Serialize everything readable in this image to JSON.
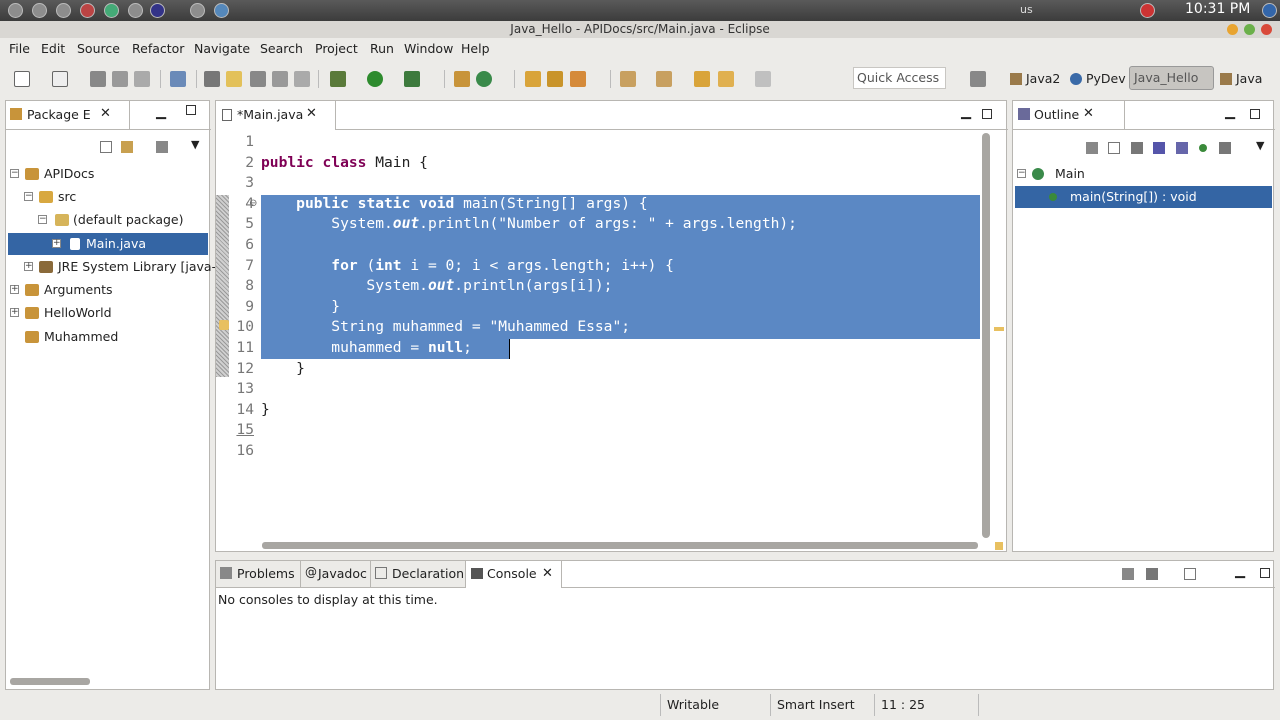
{
  "system_panel": {
    "clock": "10:31 PM",
    "keyboard": "us"
  },
  "window": {
    "title": "Java_Hello - APIDocs/src/Main.java - Eclipse"
  },
  "menu": [
    "File",
    "Edit",
    "Source",
    "Refactor",
    "Navigate",
    "Search",
    "Project",
    "Run",
    "Window",
    "Help"
  ],
  "toolbar": {
    "quick_access": "Quick Access",
    "perspectives": [
      "Java2",
      "PyDev",
      "Java_Hello",
      "Java"
    ]
  },
  "package_explorer": {
    "tab": "Package E",
    "tree": [
      {
        "label": "APIDocs",
        "level": 0,
        "expander": "−"
      },
      {
        "label": "src",
        "level": 1,
        "expander": "−"
      },
      {
        "label": "(default package)",
        "level": 2,
        "expander": "−"
      },
      {
        "label": "Main.java",
        "level": 3,
        "expander": "+",
        "selected": true
      },
      {
        "label": "JRE System Library [java-",
        "level": 1,
        "expander": "+"
      },
      {
        "label": "Arguments",
        "level": 0,
        "expander": "+"
      },
      {
        "label": "HelloWorld",
        "level": 0,
        "expander": "+"
      },
      {
        "label": "Muhammed",
        "level": 0,
        "expander": ""
      }
    ]
  },
  "editor": {
    "tab": "*Main.java",
    "line_numbers": [
      "1",
      "2",
      "3",
      "4",
      "5",
      "6",
      "7",
      "8",
      "9",
      "10",
      "11",
      "12",
      "13",
      "14",
      "15",
      "16"
    ]
  },
  "outline": {
    "tab": "Outline",
    "class_label": "Main",
    "method_label": "main(String[]) : void"
  },
  "bottom_panel": {
    "tabs": [
      "Problems",
      "Javadoc",
      "Declaration",
      "Console"
    ],
    "console_message": "No consoles to display at this time."
  },
  "status_bar": {
    "mode": "Writable",
    "insert": "Smart Insert",
    "position": "11 : 25"
  },
  "colors": {
    "selection": "#5b88c4",
    "keyword": "#7f0055",
    "string": "#2a00ff",
    "field": "#0000c0"
  }
}
